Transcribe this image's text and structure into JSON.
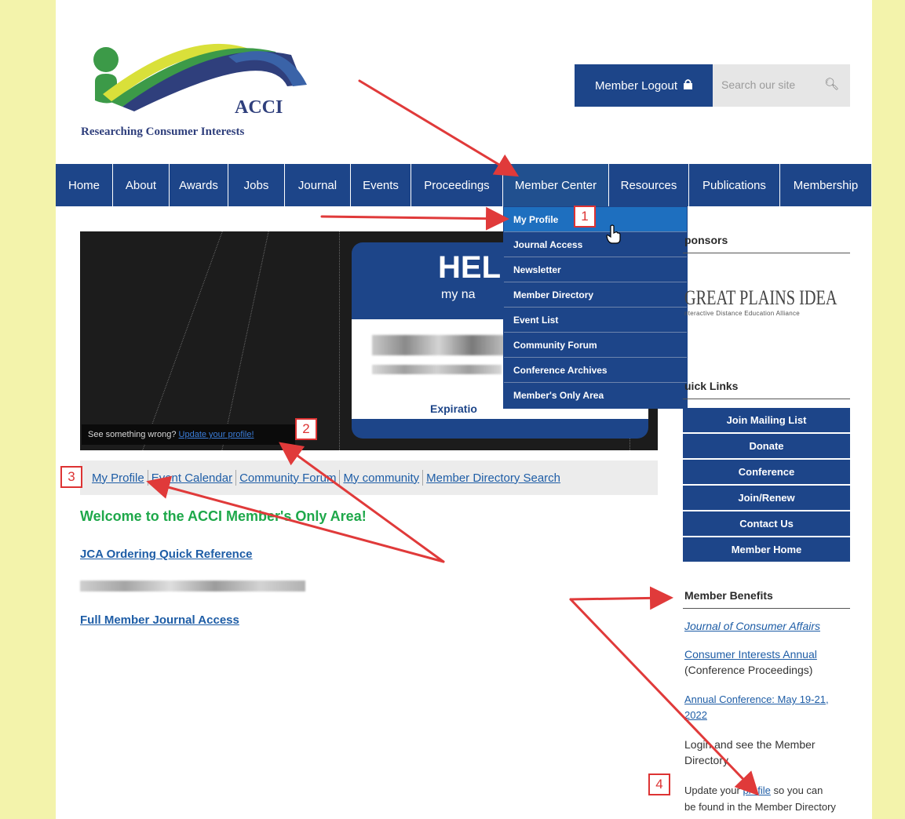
{
  "header": {
    "logo_abbrev": "ACCI",
    "logo_tagline": "Researching Consumer Interests",
    "logout_label": "Member Logout",
    "search_placeholder": "Search our site"
  },
  "nav": {
    "items": [
      "Home",
      "About",
      "Awards",
      "Jobs",
      "Journal",
      "Events",
      "Proceedings",
      "Member Center",
      "Resources",
      "Publications",
      "Membership"
    ],
    "active": "Member Center"
  },
  "dropdown": {
    "items": [
      "My Profile",
      "Journal Access",
      "Newsletter",
      "Member Directory",
      "Event List",
      "Community Forum",
      "Conference Archives",
      "Member's Only Area"
    ],
    "hovered": "My Profile"
  },
  "hero": {
    "hello": "HEL",
    "my_name": "my na",
    "expiration": "Expiratio",
    "wrong_text": "See something wrong?",
    "update_link": "Update your profile!"
  },
  "subnav": [
    "My Profile",
    "Event Calendar",
    "Community Forum",
    "My community",
    "Member Directory Search"
  ],
  "main": {
    "welcome": "Welcome to the ACCI Member's Only Area!",
    "jca_link": "JCA Ordering Quick Reference",
    "journal_link": "Full Member Journal Access"
  },
  "sidebar": {
    "sponsors_heading": "ponsors",
    "sponsor_logo": "GREAT PLAINS IDEA",
    "sponsor_sub": "nteractive Distance Education Alliance",
    "quick_heading": "uick Links",
    "quick_links": [
      "Join Mailing List",
      "Donate",
      "Conference",
      "Join/Renew",
      "Contact Us",
      "Member Home"
    ],
    "benefits_heading": "Member Benefits",
    "journal_link": "Journal of Consumer Affairs",
    "cia_link": "Consumer Interests Annual",
    "cia_note": "(Conference Proceedings)",
    "conf_link_1": "Annual Conference: May 19-21,",
    "conf_link_2": "2022",
    "login_text_1": "Login and see the Member",
    "login_text_2": "Directory",
    "update_pre": "Update your",
    "update_link": "profile",
    "update_post": "so you can",
    "update_text_2": "be found in the Member Directory"
  },
  "callouts": [
    "1",
    "2",
    "3",
    "4"
  ],
  "colors": {
    "brand_blue": "#1d4589",
    "accent_green": "#1ea84a",
    "annotation_red": "#e03a3a",
    "page_bg": "#f3f3ab"
  }
}
